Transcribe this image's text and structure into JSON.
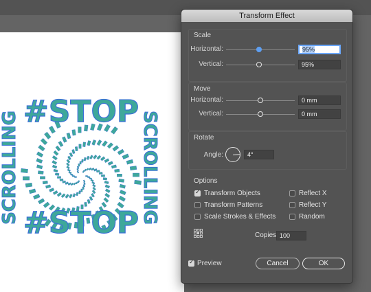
{
  "dialog": {
    "title": "Transform Effect",
    "scale": {
      "title": "Scale",
      "horizontal_label": "Horizontal:",
      "horizontal_value": "95%",
      "vertical_label": "Vertical:",
      "vertical_value": "95%"
    },
    "move": {
      "title": "Move",
      "horizontal_label": "Horizontal:",
      "horizontal_value": "0 mm",
      "vertical_label": "Vertical:",
      "vertical_value": "0 mm"
    },
    "rotate": {
      "title": "Rotate",
      "angle_label": "Angle:",
      "angle_value": "4°"
    },
    "options": {
      "title": "Options",
      "transform_objects": {
        "label": "Transform Objects",
        "checked": true
      },
      "transform_patterns": {
        "label": "Transform Patterns",
        "checked": false
      },
      "scale_strokes": {
        "label": "Scale Strokes & Effects",
        "checked": false
      },
      "reflect_x": {
        "label": "Reflect X",
        "checked": false
      },
      "reflect_y": {
        "label": "Reflect Y",
        "checked": false
      },
      "random": {
        "label": "Random",
        "checked": false
      },
      "copies_label": "Copies",
      "copies_value": "100"
    },
    "preview": {
      "label": "Preview",
      "checked": true
    },
    "cancel_label": "Cancel",
    "ok_label": "OK"
  },
  "artwork": {
    "top_text": "#STOP",
    "bottom_text": "#STOP",
    "left_text": "SCROLLING",
    "right_text": "SCROLLING",
    "fill_color": "#3ea89a",
    "stroke_color": "#3b6fd8"
  },
  "colors": {
    "accent": "#5e9ff2",
    "dialog_bg": "#535353",
    "canvas_bg": "#646464"
  }
}
